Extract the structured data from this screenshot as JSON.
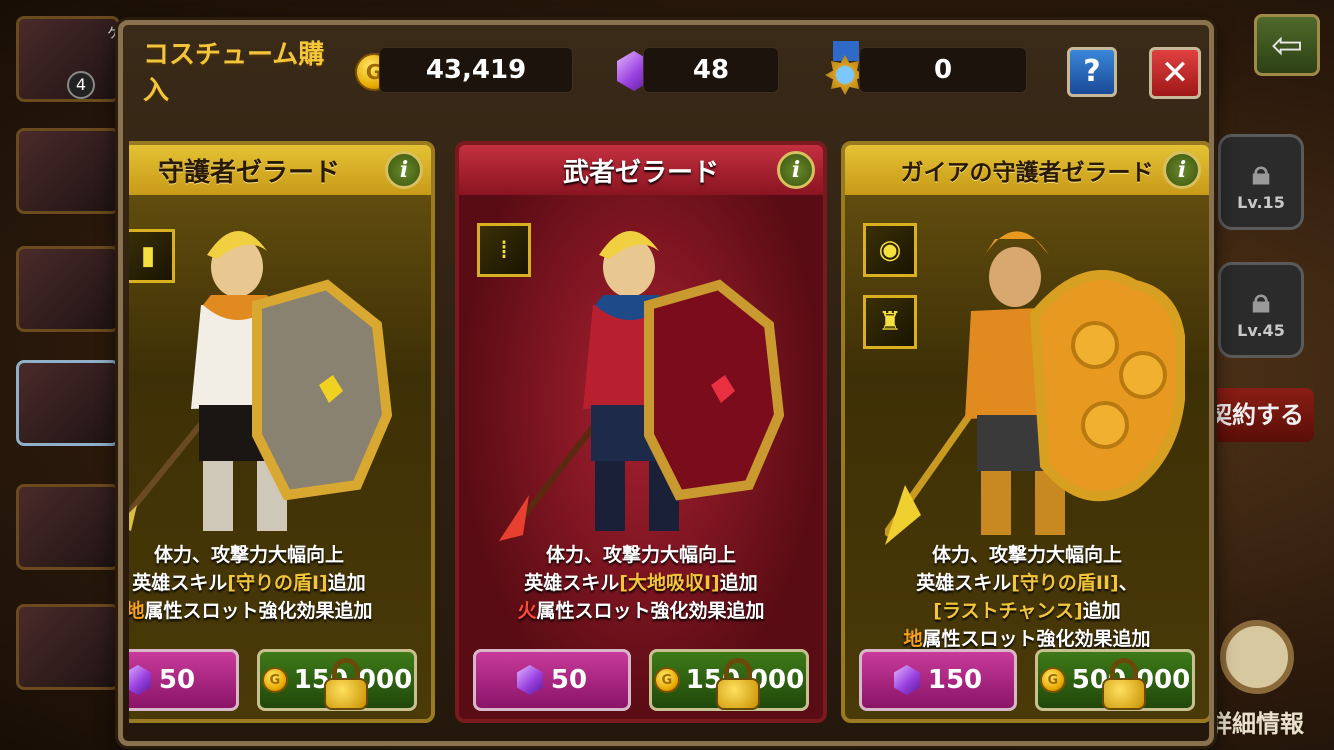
{
  "background": {
    "left_badge": "4",
    "left_name_fragment": "ケ",
    "lock_slots": [
      {
        "label": "Lv.15"
      },
      {
        "label": "Lv.45"
      }
    ],
    "contract_label": "契約する",
    "detail_label": "詳細情報"
  },
  "modal": {
    "title": "コスチューム購入",
    "gold": "43,419",
    "gems": "48",
    "medals": "0",
    "help_label": "?",
    "close_label": "✕",
    "info_label": "i"
  },
  "cards": [
    {
      "name": "守護者ゼラード",
      "theme": "gold",
      "desc_line1": "体力、攻撃力大幅向上",
      "desc_line2_pre": "英雄スキル",
      "desc_line2_hl": "[守りの盾I]",
      "desc_line2_post": "追加",
      "desc_line3_pre": "",
      "desc_line3_hl": "",
      "desc_line3_post": "",
      "element": "地",
      "slot_text": "属性スロット強化効果追加",
      "gem_price": "50",
      "gold_price": "150,000"
    },
    {
      "name": "武者ゼラード",
      "theme": "red",
      "desc_line1": "体力、攻撃力大幅向上",
      "desc_line2_pre": "英雄スキル",
      "desc_line2_hl": "[大地吸収I]",
      "desc_line2_post": "追加",
      "desc_line3_pre": "",
      "desc_line3_hl": "",
      "desc_line3_post": "",
      "element": "火",
      "slot_text": "属性スロット強化効果追加",
      "gem_price": "50",
      "gold_price": "150,000"
    },
    {
      "name": "ガイアの守護者ゼラード",
      "theme": "gold",
      "desc_line1": "体力、攻撃力大幅向上",
      "desc_line2_pre": "英雄スキル",
      "desc_line2_hl": "[守りの盾II]",
      "desc_line2_post": "、",
      "desc_line3_pre": "",
      "desc_line3_hl": "[ラストチャンス]",
      "desc_line3_post": "追加",
      "element": "地",
      "slot_text": "属性スロット強化効果追加",
      "gem_price": "150",
      "gold_price": "500,000"
    }
  ],
  "colors": {
    "gold_text": "#f3c63a",
    "fire_element": "#ff4a3a",
    "earth_element": "#f3a020",
    "gem_button": "#c83a9a",
    "gold_button": "#3e7a18"
  }
}
